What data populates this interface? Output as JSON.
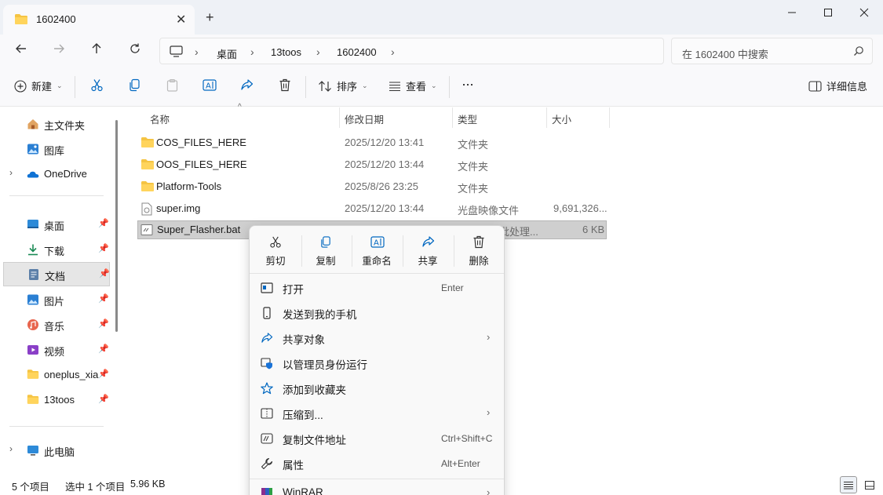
{
  "window": {
    "tab_title": "1602400",
    "new_tab": "+",
    "close_tab": "✕"
  },
  "nav": {
    "breadcrumbs": [
      "桌面",
      "13toos",
      "1602400"
    ],
    "search_placeholder": "在 1602400 中搜索"
  },
  "toolbar": {
    "new_label": "新建",
    "sort_label": "排序",
    "view_label": "查看",
    "more_label": "···",
    "details_label": "详细信息"
  },
  "sidebar": {
    "items": [
      {
        "label": "主文件夹",
        "icon": "home-icon"
      },
      {
        "label": "图库",
        "icon": "gallery-icon"
      },
      {
        "label": "OneDrive",
        "icon": "onedrive-icon"
      },
      {
        "label": "桌面",
        "icon": "desktop-icon"
      },
      {
        "label": "下载",
        "icon": "download-icon"
      },
      {
        "label": "文档",
        "icon": "documents-icon"
      },
      {
        "label": "图片",
        "icon": "pictures-icon"
      },
      {
        "label": "音乐",
        "icon": "music-icon"
      },
      {
        "label": "视频",
        "icon": "videos-icon"
      },
      {
        "label": "oneplus_xia",
        "icon": "folder-icon"
      },
      {
        "label": "13toos",
        "icon": "folder-icon"
      },
      {
        "label": "此电脑",
        "icon": "this-pc-icon"
      }
    ]
  },
  "filelist": {
    "columns": [
      "名称",
      "修改日期",
      "类型",
      "大小"
    ],
    "rows": [
      {
        "name": "COS_FILES_HERE",
        "date": "2025/12/20 13:41",
        "type": "文件夹",
        "size": ""
      },
      {
        "name": "OOS_FILES_HERE",
        "date": "2025/12/20 13:44",
        "type": "文件夹",
        "size": ""
      },
      {
        "name": "Platform-Tools",
        "date": "2025/8/26 23:25",
        "type": "文件夹",
        "size": ""
      },
      {
        "name": "super.img",
        "date": "2025/12/20 13:44",
        "type": "光盘映像文件",
        "size": "9,691,326..."
      },
      {
        "name": "Super_Flasher.bat",
        "date": "",
        "type": "批处理...",
        "size": "6 KB"
      }
    ]
  },
  "context_menu": {
    "quick_actions": [
      "剪切",
      "复制",
      "重命名",
      "共享",
      "删除"
    ],
    "items": [
      {
        "label": "打开",
        "shortcut": "Enter",
        "arrow": ""
      },
      {
        "label": "发送到我的手机",
        "shortcut": "",
        "arrow": ""
      },
      {
        "label": "共享对象",
        "shortcut": "",
        "arrow": "›"
      },
      {
        "label": "以管理员身份运行",
        "shortcut": "",
        "arrow": ""
      },
      {
        "label": "添加到收藏夹",
        "shortcut": "",
        "arrow": ""
      },
      {
        "label": "压缩到...",
        "shortcut": "",
        "arrow": "›"
      },
      {
        "label": "复制文件地址",
        "shortcut": "Ctrl+Shift+C",
        "arrow": ""
      },
      {
        "label": "属性",
        "shortcut": "Alt+Enter",
        "arrow": ""
      },
      {
        "label": "WinRAR",
        "shortcut": "",
        "arrow": "›"
      }
    ]
  },
  "status": {
    "count": "5 个项目",
    "selected": "选中 1 个项目",
    "size": "5.96 KB"
  },
  "colors": {
    "accent": "#0067c0",
    "folder": "#f5c443",
    "titlebar": "#eef1f6"
  }
}
